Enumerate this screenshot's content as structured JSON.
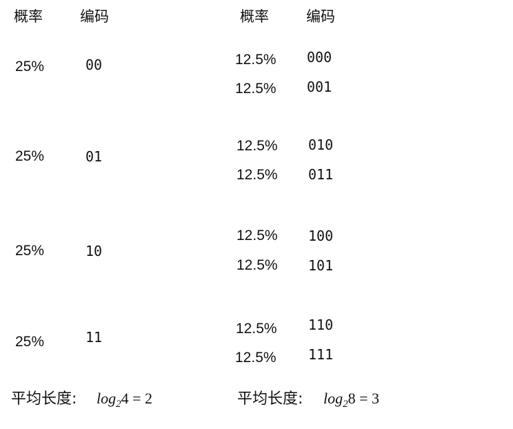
{
  "left": {
    "header_prob": "概率",
    "header_code": "编码",
    "rows": [
      {
        "prob": "25%",
        "code": "00"
      },
      {
        "prob": "25%",
        "code": "01"
      },
      {
        "prob": "25%",
        "code": "10"
      },
      {
        "prob": "25%",
        "code": "11"
      }
    ],
    "avg_label": "平均长度:",
    "formula": {
      "fn": "log",
      "base": "2",
      "arg": "4",
      "op": "=",
      "result": "2"
    }
  },
  "right": {
    "header_prob": "概率",
    "header_code": "编码",
    "rows": [
      {
        "prob": "12.5%",
        "code": "000"
      },
      {
        "prob": "12.5%",
        "code": "001"
      },
      {
        "prob": "12.5%",
        "code": "010"
      },
      {
        "prob": "12.5%",
        "code": "011"
      },
      {
        "prob": "12.5%",
        "code": "100"
      },
      {
        "prob": "12.5%",
        "code": "101"
      },
      {
        "prob": "12.5%",
        "code": "110"
      },
      {
        "prob": "12.5%",
        "code": "111"
      }
    ],
    "avg_label": "平均长度:",
    "formula": {
      "fn": "log",
      "base": "2",
      "arg": "8",
      "op": "=",
      "result": "3"
    }
  }
}
